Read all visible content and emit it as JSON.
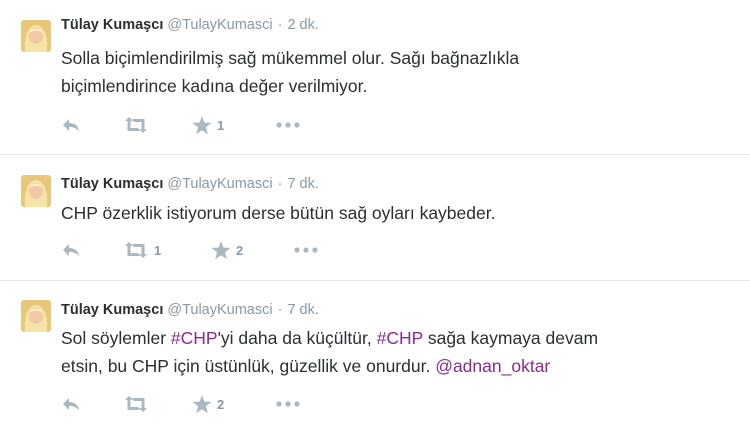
{
  "tweets": [
    {
      "name": "Tülay Kumaşcı",
      "handle": "@TulayKumasci",
      "separator": "·",
      "time": "2 dk.",
      "text_line1": "Solla biçimlendirilmiş sağ mükemmel olur. Sağı bağnazlıkla",
      "text_line2": "biçimlendirince kadına değer verilmiyor.",
      "retweet_count": "",
      "favorite_count": "1"
    },
    {
      "name": "Tülay Kumaşcı",
      "handle": "@TulayKumasci",
      "separator": "·",
      "time": "7 dk.",
      "text_line1": "CHP özerklik istiyorum derse bütün sağ oyları kaybeder.",
      "retweet_count": "1",
      "favorite_count": "2"
    },
    {
      "name": "Tülay Kumaşcı",
      "handle": "@TulayKumasci",
      "separator": "·",
      "time": "7 dk.",
      "line1_part1": "Sol söylemler ",
      "line1_tag1": "#CHP",
      "line1_part2": "'yi daha da küçültür, ",
      "line1_tag2": "#CHP",
      "line1_part3": " sağa kaymaya devam",
      "line2_part1": "etsin, bu CHP için üstünlük, güzellik ve onurdur. ",
      "line2_mention": "@adnan_oktar",
      "retweet_count": "",
      "favorite_count": "2"
    }
  ],
  "icons": {
    "reply": "reply-icon",
    "retweet": "retweet-icon",
    "favorite": "star-icon",
    "more": "more-icon"
  },
  "colors": {
    "link": "#8a2a91",
    "muted": "#8899a6",
    "icon": "#aab8c2"
  }
}
